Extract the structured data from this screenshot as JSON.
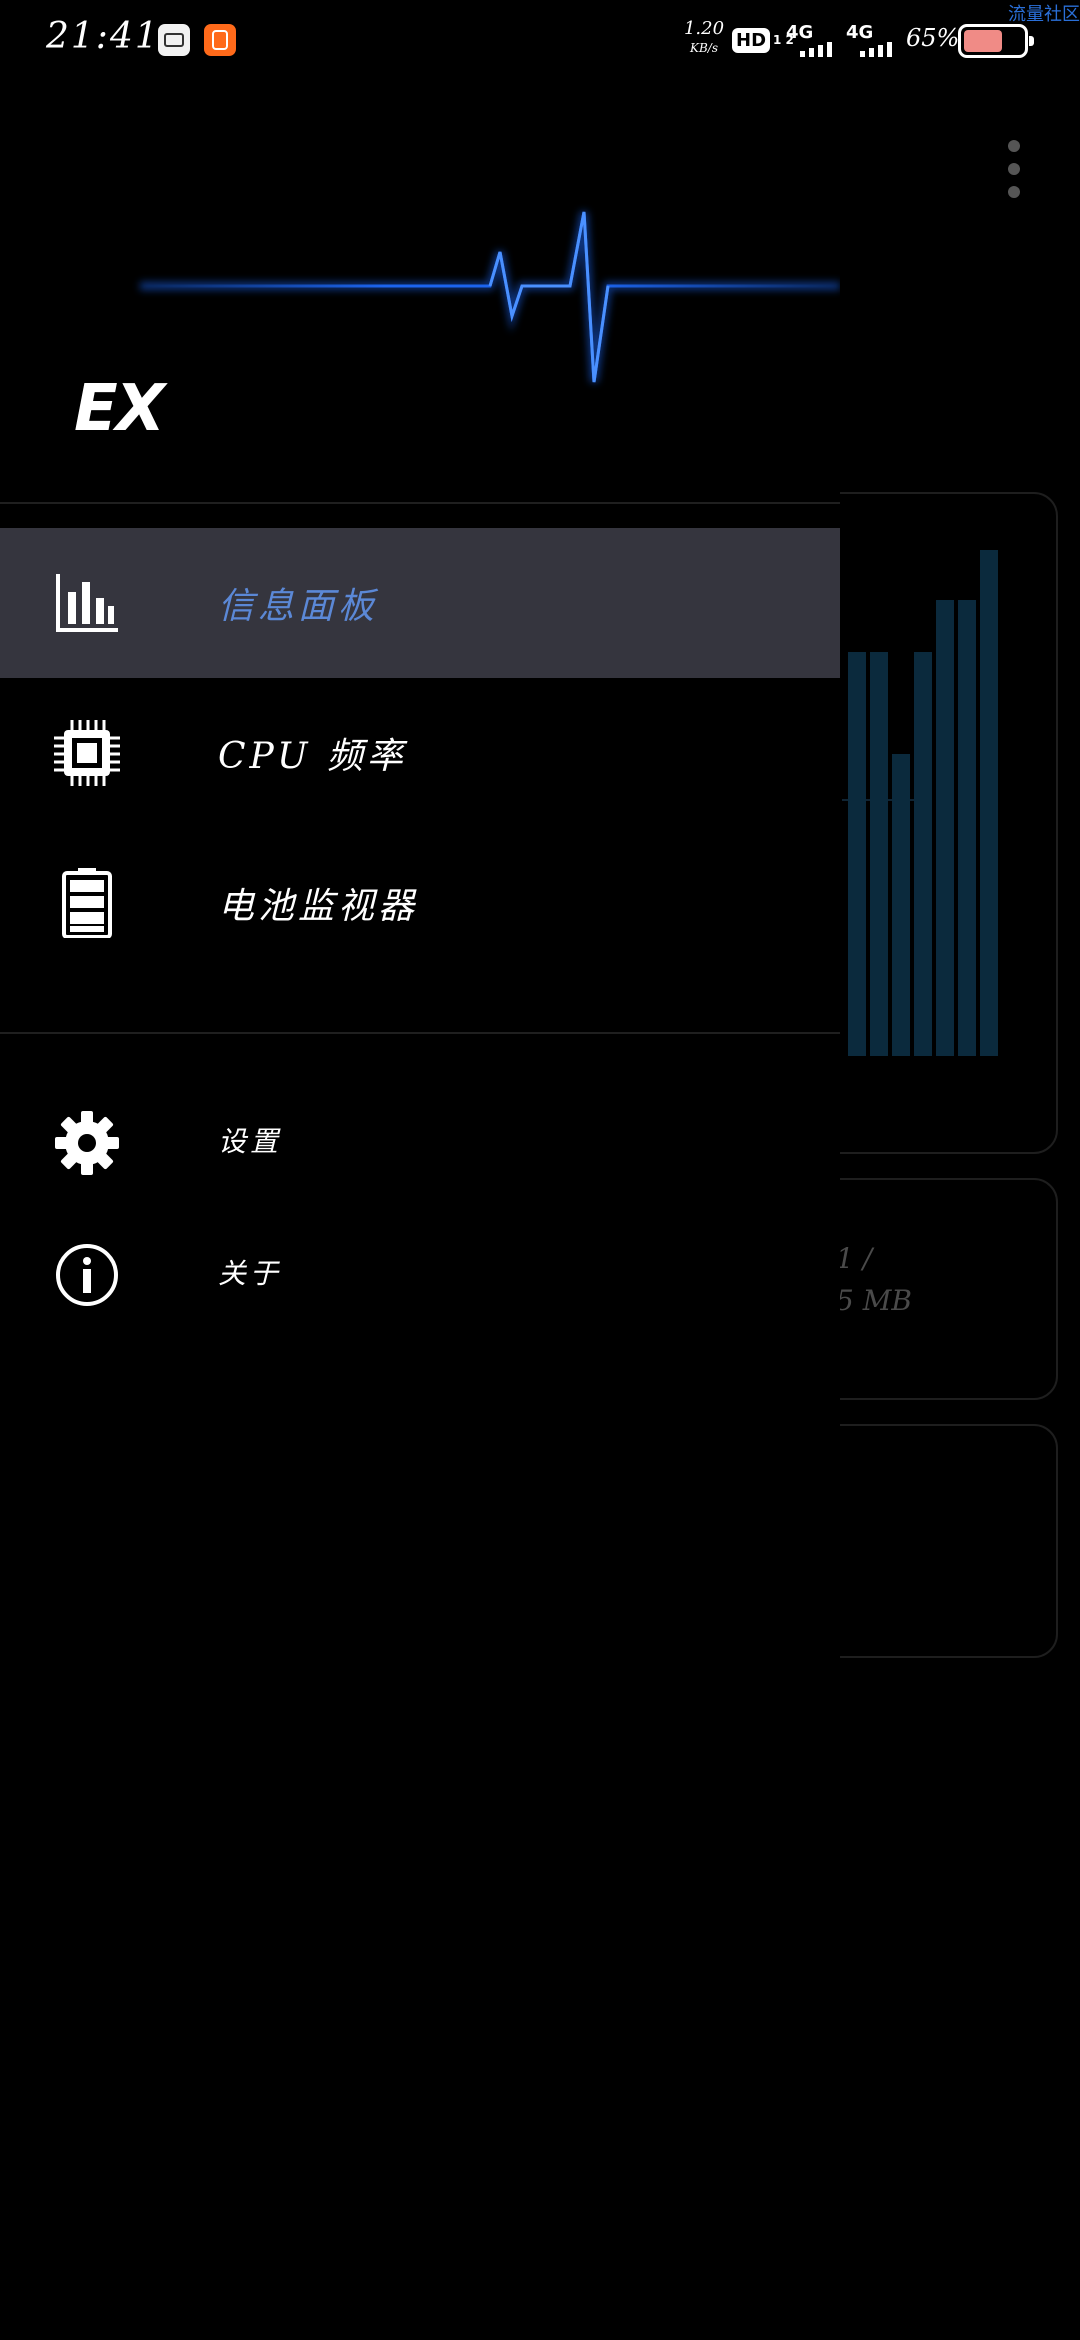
{
  "status_bar": {
    "time": "21:41",
    "net_speed_value": "1.20",
    "net_speed_unit": "KB/s",
    "hd_badge": "HD",
    "hd_numbers": "1 2",
    "signal1_label": "4G",
    "signal2_label": "4G",
    "battery_percent": "65%",
    "battery_level": 0.65,
    "app_icons": [
      "game-controller-icon",
      "kuaishou-icon"
    ]
  },
  "watermark": "流量社区",
  "drawer": {
    "logo": "EX",
    "menu": [
      {
        "label": "信息面板",
        "icon": "bar-chart-icon",
        "active": true
      },
      {
        "label": "CPU 频率",
        "icon": "cpu-chip-icon",
        "active": false
      },
      {
        "label": "电池监视器",
        "icon": "battery-icon",
        "active": false
      }
    ],
    "secondary": [
      {
        "label": "设置",
        "icon": "gear-icon"
      },
      {
        "label": "关于",
        "icon": "info-icon"
      }
    ]
  },
  "background": {
    "ram_line1": "1 /",
    "ram_line2": "5 MB"
  },
  "colors": {
    "accent_blue": "#5b88d6",
    "active_item_bg": "#35353e",
    "pulse_blue": "#1e6bff",
    "chart_bar": "#0b2a3d"
  }
}
